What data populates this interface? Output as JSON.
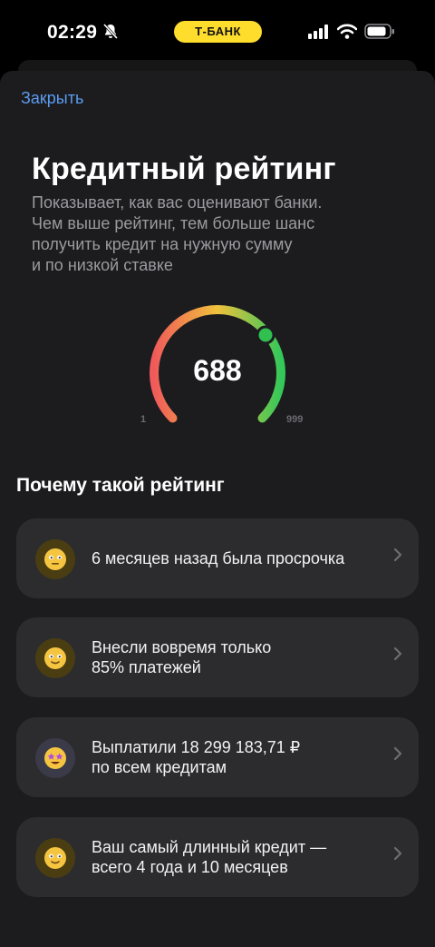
{
  "status_bar": {
    "time": "02:29",
    "bank_badge": "Т-БАНК",
    "icons": [
      "bell-slash-icon",
      "signal-icon",
      "wifi-icon",
      "battery-icon"
    ],
    "badge_color": "#ffdd2d"
  },
  "header": {
    "close_label": "Закрыть"
  },
  "main": {
    "title": "Кредитный рейтинг",
    "subtitle_lines": [
      "Показывает, как вас оценивают банки.",
      "Чем выше рейтинг, тем больше шанс",
      "получить кредит на нужную сумму",
      "и по низкой ставке"
    ]
  },
  "gauge": {
    "score": "688",
    "min": "1",
    "max": "999",
    "colors": [
      "#f05a5a",
      "#f0c23c",
      "#34c759"
    ]
  },
  "reasons": {
    "title": "Почему такой рейтинг",
    "items": [
      {
        "lines": [
          "6 месяцев назад была просрочка"
        ],
        "icon": "neutral-face-icon"
      },
      {
        "lines": [
          "Внесли вовремя только",
          "85% платежей"
        ],
        "icon": "smile-face-icon"
      },
      {
        "lines": [
          "Выплатили 18 299 183,71 ₽",
          "по всем кредитам"
        ],
        "icon": "star-eyes-face-icon"
      },
      {
        "lines": [
          "Ваш самый длинный кредит —",
          "всего 4 года и 10 месяцев"
        ],
        "icon": "smile-face-icon"
      }
    ]
  }
}
